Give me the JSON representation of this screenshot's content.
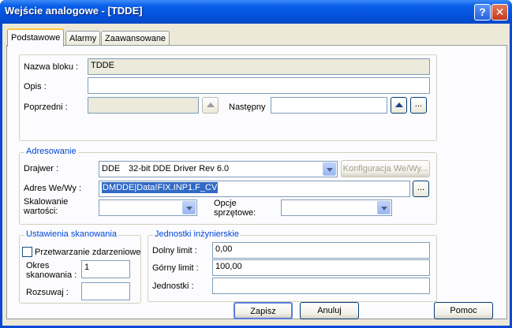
{
  "window": {
    "title": "Wejście analogowe - [TDDE]",
    "help_glyph": "?",
    "close_glyph": "✕"
  },
  "tabs": [
    {
      "label": "Podstawowe",
      "active": true
    },
    {
      "label": "Alarmy",
      "active": false
    },
    {
      "label": "Zaawansowane",
      "active": false
    }
  ],
  "block": {
    "name_label": "Nazwa bloku :",
    "name_value": "TDDE",
    "desc_label": "Opis :",
    "desc_value": "",
    "prev_label": "Poprzedni :",
    "prev_value": "",
    "next_label": "Następny",
    "next_value": "",
    "browse": "..."
  },
  "addressing": {
    "legend": "Adresowanie",
    "driver_label": "Drajwer :",
    "driver_code": "DDE",
    "driver_name": "32-bit DDE Driver Rev 6.0",
    "config_button": "Konfiguracja We/Wy...",
    "address_label": "Adres We/Wy :",
    "address_value": "DMDDE|Data!FIX.INP1.F_CV",
    "browse": "...",
    "scaling_label_1": "Skalowanie",
    "scaling_label_2": "wartości:",
    "scaling_value": "",
    "hw_label_1": "Opcje",
    "hw_label_2": "sprzętowe:",
    "hw_value": ""
  },
  "scan": {
    "legend": "Ustawienia skanowania",
    "event_label": "Przetwarzanie zdarzeniowe",
    "event_checked": false,
    "period_label_1": "Okres",
    "period_label_2": "skanowania :",
    "period_value": "1",
    "phase_label": "Rozsuwaj :",
    "phase_value": ""
  },
  "eng": {
    "legend": "Jednostki inżynierskie",
    "low_label": "Dolny limit :",
    "low_value": "0,00",
    "high_label": "Górny limit :",
    "high_value": "100,00",
    "units_label": "Jednostki :",
    "units_value": ""
  },
  "footer": {
    "save": "Zapisz",
    "cancel": "Anuluj",
    "help": "Pomoc"
  }
}
